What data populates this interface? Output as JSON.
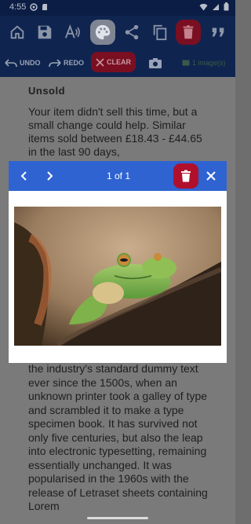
{
  "status_bar": {
    "time": "4:55"
  },
  "toolbar": {
    "icons": [
      "home-icon",
      "save-icon",
      "text-to-speech-icon",
      "palette-icon",
      "share-icon",
      "copy-icon",
      "delete-icon",
      "quote-icon"
    ],
    "undo_label": "UNDO",
    "redo_label": "REDO",
    "clear_label": "CLEAR",
    "images_label": "1 image(s)"
  },
  "note": {
    "heading": "Unsold",
    "paragraph_top": "Your item didn't sell this time, but a small change could help. Similar items sold between £18.43 - £44.65 in the last 90 days,",
    "paragraph_bottom": "the industry's standard dummy text ever since the 1500s, when an unknown printer took a galley of type and scrambled it to make a type specimen book. It has survived not only five centuries, but also the leap into electronic typesetting, remaining essentially unchanged. It was popularised in the 1960s with the release of Letraset sheets containing Lorem"
  },
  "image_viewer": {
    "pager": "1 of 1",
    "image_alt": "green tree frog on a branch"
  },
  "colors": {
    "toolbar": "#0f2550",
    "dialog_bar": "#2f63d1",
    "delete": "#b0102b"
  }
}
